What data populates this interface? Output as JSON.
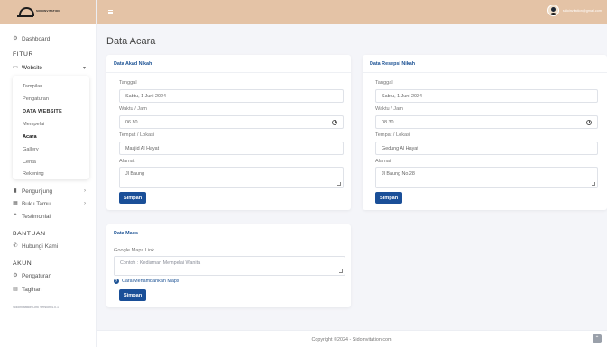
{
  "brand": {
    "logo_line1": "SIDOINVITATION"
  },
  "sidebar": {
    "dashboard": "Dashboard",
    "fitur_heading": "FITUR",
    "website": "Website",
    "submenu": {
      "tampilan": "Tampilan",
      "pengaturan": "Pengaturan",
      "header": "DATA WEBSITE",
      "mempelai": "Mempelai",
      "acara": "Acara",
      "gallery": "Gallery",
      "cerita": "Cerita",
      "rekening": "Rekening"
    },
    "pengunjung": "Pengunjung",
    "buku_tamu": "Buku Tamu",
    "testimonial": "Testimonial",
    "bantuan_heading": "BANTUAN",
    "hubungi": "Hubungi Kami",
    "akun_heading": "AKUN",
    "pengaturan": "Pengaturan",
    "tagihan": "Tagihan",
    "version": "Sidoinvitation Link Version 4.0.1"
  },
  "topbar": {
    "user_email": "sidoinvitation@gmail.com"
  },
  "page": {
    "title": "Data Acara"
  },
  "akad": {
    "title": "Data Akad Nikah",
    "tanggal_label": "Tanggal",
    "tanggal_value": "Sabtu, 1 Juni 2024",
    "waktu_label": "Waktu / Jam",
    "waktu_value": "06.30",
    "tempat_label": "Tempat / Lokasi",
    "tempat_value": "Masjid Al Hayat",
    "alamat_label": "Alamat",
    "alamat_value": "Jl Baung",
    "save": "Simpan"
  },
  "resepsi": {
    "title": "Data Resepsi Nikah",
    "tanggal_label": "Tanggal",
    "tanggal_value": "Sabtu, 1 Juni 2024",
    "waktu_label": "Waktu / Jam",
    "waktu_value": "08.30",
    "tempat_label": "Tempat / Lokasi",
    "tempat_value": "Gedung Al Hayat",
    "alamat_label": "Alamat",
    "alamat_value": "Jl Baung No.28",
    "save": "Simpan"
  },
  "maps": {
    "title": "Data Maps",
    "link_label": "Google Maps Link",
    "link_placeholder": "Contoh : Kediaman Mempelai Wanita",
    "help": "Cara Menambahkan Maps",
    "save": "Simpan"
  },
  "footer": {
    "text": "Copyright ©2024 - Sidoinvitation.com"
  },
  "colors": {
    "topbar": "#e4c3a6",
    "primary": "#1a4f98",
    "title_blue": "#1c5294"
  }
}
